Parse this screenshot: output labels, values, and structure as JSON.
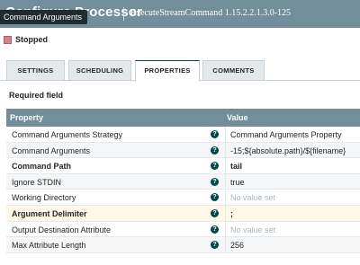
{
  "header": {
    "title": "Configure Processor",
    "subtitle": "ExecuteStreamCommand 1.15.2.2.1.3.0-125"
  },
  "tooltip": "Command Arguments",
  "status": {
    "label": "Stopped",
    "icon": "stop-icon",
    "color": "#d18686"
  },
  "tabs": [
    {
      "label": "SETTINGS",
      "active": false
    },
    {
      "label": "SCHEDULING",
      "active": false
    },
    {
      "label": "PROPERTIES",
      "active": true
    },
    {
      "label": "COMMENTS",
      "active": false
    }
  ],
  "required_label": "Required field",
  "table": {
    "headers": {
      "property": "Property",
      "value": "Value"
    },
    "rows": [
      {
        "property": "Command Arguments Strategy",
        "value": "Command Arguments Property",
        "required": false,
        "empty": false
      },
      {
        "property": "Command Arguments",
        "value": "-15;${absolute.path}/${filename}",
        "required": false,
        "empty": false
      },
      {
        "property": "Command Path",
        "value": "tail",
        "required": true,
        "empty": false
      },
      {
        "property": "Ignore STDIN",
        "value": "true",
        "required": false,
        "empty": false
      },
      {
        "property": "Working Directory",
        "value": "No value set",
        "required": false,
        "empty": true
      },
      {
        "property": "Argument Delimiter",
        "value": ";",
        "required": true,
        "empty": false
      },
      {
        "property": "Output Destination Attribute",
        "value": "No value set",
        "required": false,
        "empty": true
      },
      {
        "property": "Max Attribute Length",
        "value": "256",
        "required": false,
        "empty": false
      }
    ]
  },
  "colors": {
    "header_bg": "#728e9b",
    "accent": "#004849",
    "highlight_row": "#fdf9e6"
  }
}
